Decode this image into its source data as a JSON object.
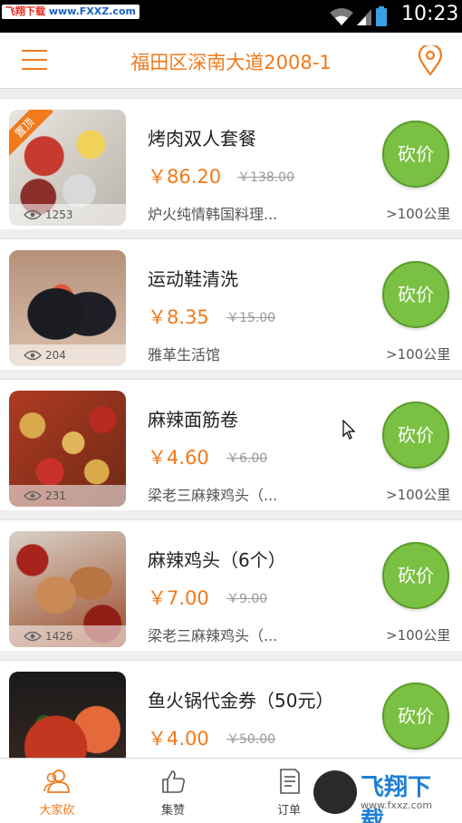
{
  "status_bar": {
    "watermark": "飞翔下载 www.FXXZ.com",
    "watermark_red": "飞翔下载",
    "watermark_blue": "www.FXXZ.com",
    "time": "10:23",
    "icons": [
      "wifi-icon",
      "signal-icon",
      "battery-icon"
    ]
  },
  "header": {
    "title": "福田区深南大道2008-1",
    "left_icon": "menu-icon",
    "right_icon": "location-pin-icon"
  },
  "accent_color": "#f07a1c",
  "button_color": "#7ac143",
  "items": [
    {
      "name": "烤肉双人套餐",
      "price": "￥86.20",
      "original_price": "￥138.00",
      "shop": "炉火纯情韩国料理...",
      "distance": ">100公里",
      "views": "1253",
      "badge": "置顶",
      "action": "砍价"
    },
    {
      "name": "运动鞋清洗",
      "price": "￥8.35",
      "original_price": "￥15.00",
      "shop": "雅革生活馆",
      "distance": ">100公里",
      "views": "204",
      "action": "砍价"
    },
    {
      "name": "麻辣面筋卷",
      "price": "￥4.60",
      "original_price": "￥6.00",
      "shop": "梁老三麻辣鸡头（...",
      "distance": ">100公里",
      "views": "231",
      "action": "砍价"
    },
    {
      "name": "麻辣鸡头（6个）",
      "price": "￥7.00",
      "original_price": "￥9.00",
      "shop": "梁老三麻辣鸡头（...",
      "distance": ">100公里",
      "views": "1426",
      "action": "砍价"
    },
    {
      "name": "鱼火锅代金券（50元）",
      "price": "￥4.00",
      "original_price": "￥50.00",
      "shop": "",
      "distance": "",
      "views": "",
      "action": "砍价"
    }
  ],
  "tabs": [
    {
      "label": "大家砍",
      "icon": "people-icon",
      "active": true
    },
    {
      "label": "集赞",
      "icon": "thumbs-up-icon",
      "active": false
    },
    {
      "label": "订单",
      "icon": "order-list-icon",
      "active": false
    }
  ],
  "bottom_watermark": {
    "text": "飞翔下载",
    "url": "www.fxxz.com"
  }
}
